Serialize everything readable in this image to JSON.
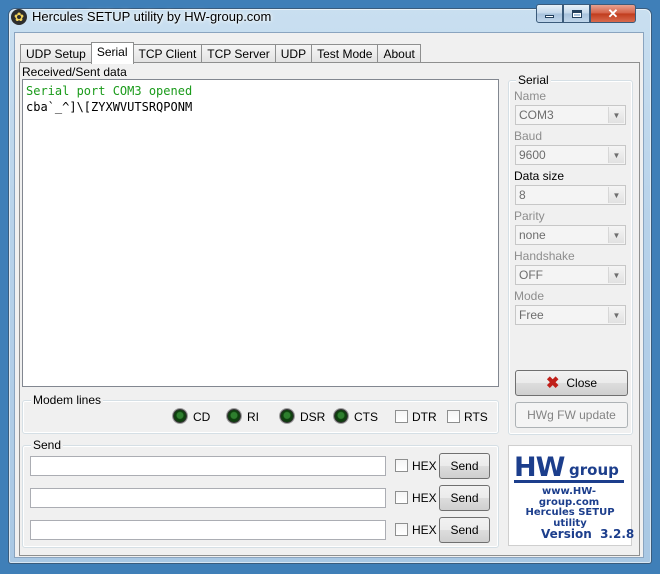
{
  "window": {
    "title": "Hercules SETUP utility by HW-group.com",
    "close_glyph": "✕"
  },
  "tabs": [
    {
      "label": "UDP Setup",
      "active": false
    },
    {
      "label": "Serial",
      "active": true
    },
    {
      "label": "TCP Client",
      "active": false
    },
    {
      "label": "TCP Server",
      "active": false
    },
    {
      "label": "UDP",
      "active": false
    },
    {
      "label": "Test Mode",
      "active": false
    },
    {
      "label": "About",
      "active": false
    }
  ],
  "received": {
    "label": "Received/Sent data",
    "lines": [
      {
        "text": "Serial port COM3 opened",
        "color": "#1b9b1b"
      },
      {
        "text": "cba`_^]\\[ZYXWVUTSRQPONM",
        "color": "#000000"
      }
    ]
  },
  "serial": {
    "title": "Serial",
    "fields": [
      {
        "label": "Name",
        "value": "COM3",
        "enabled": false
      },
      {
        "label": "Baud",
        "value": "9600",
        "enabled": false
      },
      {
        "label": "Data size",
        "value": "8",
        "enabled": true
      },
      {
        "label": "Parity",
        "value": "none",
        "enabled": false
      },
      {
        "label": "Handshake",
        "value": "OFF",
        "enabled": false
      },
      {
        "label": "Mode",
        "value": "Free",
        "enabled": false
      }
    ],
    "close_label": "Close",
    "fw_update_label": "HWg FW update"
  },
  "modem": {
    "title": "Modem lines",
    "leds": [
      "CD",
      "RI",
      "DSR",
      "CTS"
    ],
    "checkboxes": [
      "DTR",
      "RTS"
    ]
  },
  "send": {
    "title": "Send",
    "rows": [
      {
        "value": "",
        "hex_label": "HEX",
        "button_label": "Send"
      },
      {
        "value": "",
        "hex_label": "HEX",
        "button_label": "Send"
      },
      {
        "value": "",
        "hex_label": "HEX",
        "button_label": "Send"
      }
    ]
  },
  "logo": {
    "hw": "HW",
    "group": "group",
    "url": "www.HW-group.com",
    "product": "Hercules SETUP utility",
    "version": "Version  3.2.8"
  },
  "colors": {
    "desktop": "#3f7fb8",
    "brand_blue": "#1c3e8c",
    "log_green": "#1b9b1b",
    "close_red": "#c0201a"
  }
}
